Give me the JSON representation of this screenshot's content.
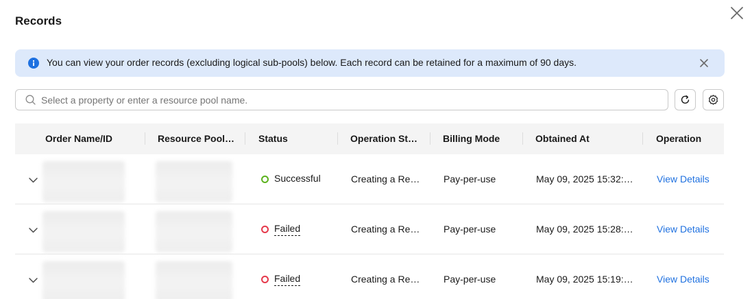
{
  "dialog": {
    "title": "Records",
    "notice": "You can view your order records (excluding logical sub-pools) below. Each record can be retained for a maximum of 90 days."
  },
  "search": {
    "placeholder": "Select a property or enter a resource pool name."
  },
  "table": {
    "columns": [
      "Order Name/ID",
      "Resource Pool…",
      "Status",
      "Operation St…",
      "Billing Mode",
      "Obtained At",
      "Operation"
    ],
    "rows": [
      {
        "status": "Successful",
        "operation_status": "Creating a Re…",
        "billing_mode": "Pay-per-use",
        "obtained_at": "May 09, 2025 15:32:…",
        "action": "View Details"
      },
      {
        "status": "Failed",
        "operation_status": "Creating a Re…",
        "billing_mode": "Pay-per-use",
        "obtained_at": "May 09, 2025 15:28:…",
        "action": "View Details"
      },
      {
        "status": "Failed",
        "operation_status": "Creating a Re…",
        "billing_mode": "Pay-per-use",
        "obtained_at": "May 09, 2025 15:19:…",
        "action": "View Details"
      }
    ]
  },
  "colors": {
    "accent": "#1f71e0",
    "success": "#5bb21c",
    "failed": "#e5384a",
    "notice_bg": "#dde9fb"
  },
  "icons": [
    "close-icon",
    "info-icon",
    "search-icon",
    "refresh-icon",
    "settings-icon",
    "chevron-down-icon"
  ]
}
